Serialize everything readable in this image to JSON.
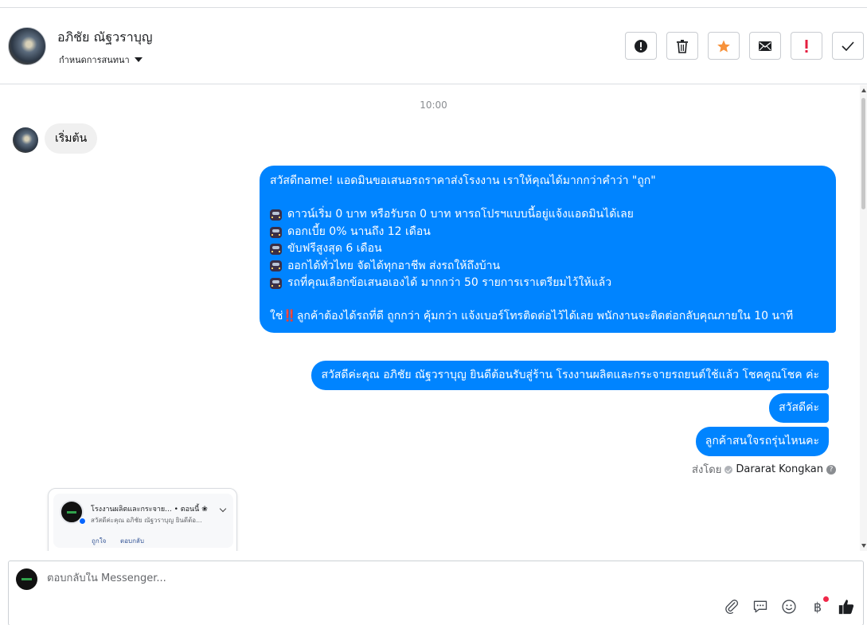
{
  "header": {
    "contact_name": "อภิชัย ณัฐวราบุญ",
    "assign_label": "กำหนดการสนทนา",
    "actions": [
      {
        "name": "report-icon",
        "label": ""
      },
      {
        "name": "trash-icon",
        "label": ""
      },
      {
        "name": "star-icon",
        "label": ""
      },
      {
        "name": "envelope-icon",
        "label": ""
      },
      {
        "name": "important-icon",
        "label": ""
      },
      {
        "name": "check-icon",
        "label": ""
      }
    ],
    "colors": {
      "star": "#f7923b",
      "important": "#e41e3f"
    }
  },
  "thread": {
    "timestamp": "10:00",
    "incoming": [
      {
        "text": "เริ่มต้น"
      }
    ],
    "outgoing_main": {
      "line1": "สวัสดีname! แอดมินขอเสนอรถราคาส่งโรงงาน เราให้คุณได้มากกว่าคำว่า \"ถูก\"",
      "bullets": [
        "ดาวน์เริ่ม 0 บาท หรือรับรถ 0 บาท หารถโปรฯแบบนี้อยู่แจ้งแอดมินได้เลย",
        "ดอกเบี้ย 0% นานถึง 12 เดือน",
        "ขับฟรีสูงสุด 6 เดือน",
        "ออกได้ทั่วไทย จัดได้ทุกอาชีพ ส่งรถให้ถึงบ้าน",
        "รถที่คุณเลือกข้อเสนอเองได้ มากกว่า 50 รายการเราเตรียมไว้ให้แล้ว"
      ],
      "closing_prefix": "ใช่",
      "closing_mark": "‼️",
      "closing_rest": "ลูกค้าต้องได้รถที่ดี ถูกกว่า คุ้มกว่า แจ้งเบอร์โทรติดต่อไว้ได้เลย พนักงานจะติดต่อกลับคุณภายใน 10 นาที"
    },
    "outgoing": [
      {
        "text": "สวัสดีค่ะคุณ อภิชัย ณัฐวราบุญ ยินดีต้อนรับสู่ร้าน โรงงานผลิตและกระจายรถยนต์ใช้แล้ว โชคคูณโชค ค่ะ"
      },
      {
        "text": "สวัสดีค่ะ"
      },
      {
        "text": "ลูกค้าสนใจรถรุ่นไหนคะ"
      }
    ],
    "sent_by_label": "ส่งโดย",
    "sent_by_name": "Dararat Kongkan",
    "bubble_color": "#0084ff",
    "preview": {
      "title": "โรงงานผลิตและกระจาย... • ตอนนี้ ❀",
      "snippet": "สวัสดีค่ะคุณ อภิชัย ณัฐวราบุญ ยินดีต้อ...",
      "like": "ถูกใจ",
      "reply": "ตอบกลับ"
    }
  },
  "composer": {
    "placeholder": "ตอบกลับใน Messenger...",
    "tools": [
      "paperclip-icon",
      "saved-reply-icon",
      "emoji-icon",
      "baht-icon",
      "thumbs-up-icon"
    ],
    "baht_symbol": "฿"
  }
}
